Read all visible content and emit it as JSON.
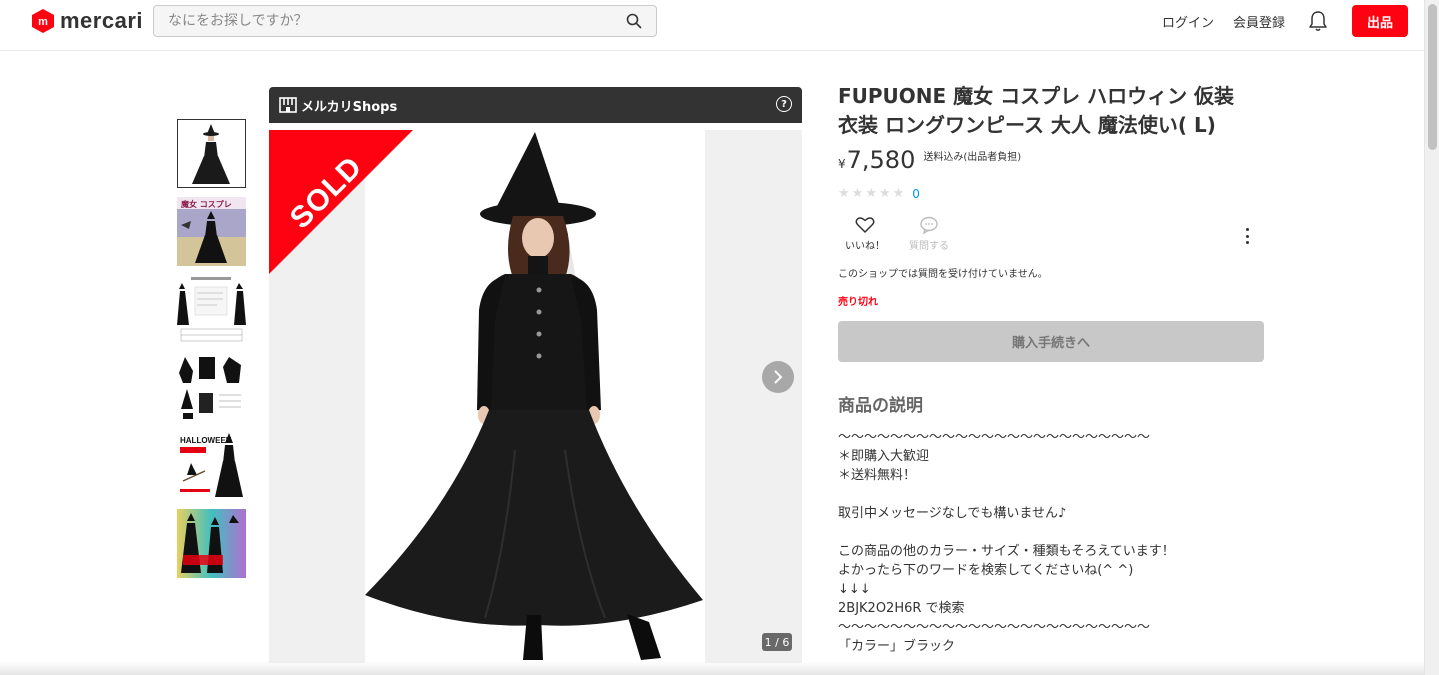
{
  "header": {
    "logo_text": "mercari",
    "search_placeholder": "なにをお探しですか？",
    "login_label": "ログイン",
    "signup_label": "会員登録",
    "sell_label": "出品",
    "brand_color": "#ff0211"
  },
  "gallery": {
    "thumbnail_count": 6,
    "active_index": 0,
    "shops_label": "メルカリShops",
    "sold_label": "SOLD",
    "counter": "1 / 6"
  },
  "product": {
    "title_line1": "FUPUONE 魔女 コスプレ ハロウィン 仮装",
    "title_line2": "衣装 ロングワンピース 大人 魔法使い( L)",
    "currency": "¥",
    "price": "7,580",
    "shipping": "送料込み(出品者負担)",
    "rating_stars": 0,
    "rating_count": "0",
    "like_label": "いいね！",
    "question_label": "質問する",
    "no_question_note": "このショップでは質問を受け付けていません。",
    "status": "売り切れ",
    "buy_label": "購入手続きへ"
  },
  "description": {
    "heading": "商品の説明",
    "lines": [
      "〜〜〜〜〜〜〜〜〜〜〜〜〜〜〜〜〜〜〜〜〜〜〜〜",
      "＊即購入大歓迎",
      "＊送料無料！",
      "",
      "取引中メッセージなしでも構いません♪",
      "",
      "この商品の他のカラー・サイズ・種類もそろえています！",
      "よかったら下のワードを検索してくださいね(^ ^)",
      "↓↓↓",
      "2BJK2O2H6R で検索",
      "〜〜〜〜〜〜〜〜〜〜〜〜〜〜〜〜〜〜〜〜〜〜〜〜",
      "「カラー」ブラック"
    ]
  }
}
